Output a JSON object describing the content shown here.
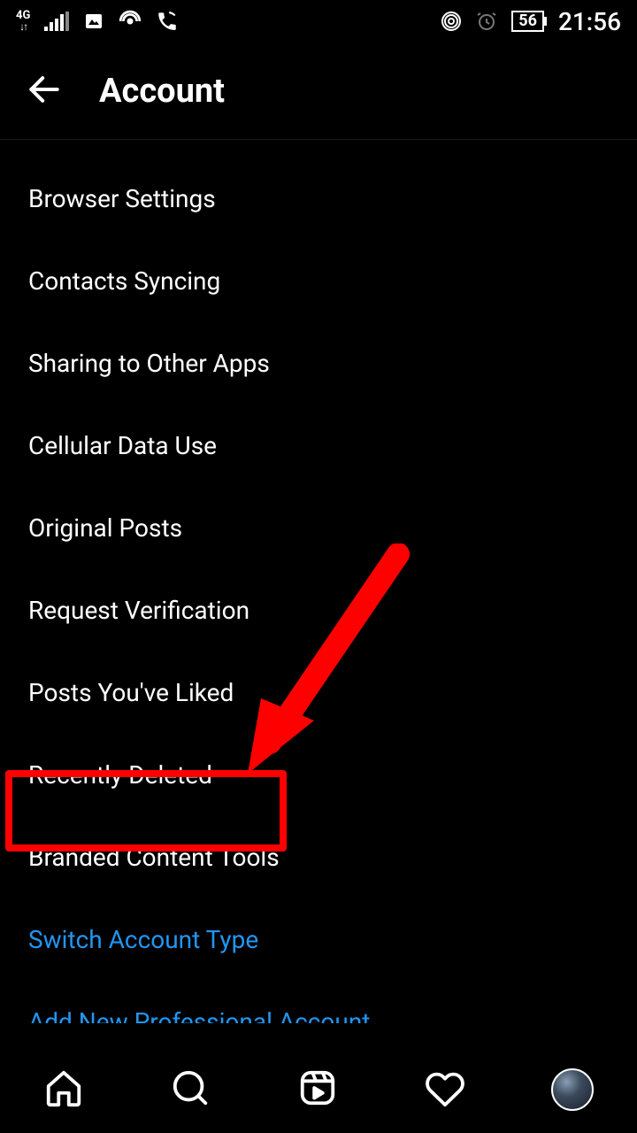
{
  "status": {
    "network_label": "4G",
    "battery": "56",
    "time": "21:56"
  },
  "header": {
    "title": "Account"
  },
  "menu": {
    "items": [
      {
        "label": "Browser Settings",
        "style": "normal"
      },
      {
        "label": "Contacts Syncing",
        "style": "normal"
      },
      {
        "label": "Sharing to Other Apps",
        "style": "normal"
      },
      {
        "label": "Cellular Data Use",
        "style": "normal"
      },
      {
        "label": "Original Posts",
        "style": "normal"
      },
      {
        "label": "Request Verification",
        "style": "normal"
      },
      {
        "label": "Posts You've Liked",
        "style": "normal"
      },
      {
        "label": "Recently Deleted",
        "style": "normal",
        "highlighted": true
      },
      {
        "label": "Branded Content Tools",
        "style": "normal"
      },
      {
        "label": "Switch Account Type",
        "style": "link"
      },
      {
        "label": "Add New Professional Account",
        "style": "link-cutoff"
      }
    ]
  },
  "annotation": {
    "target_label": "Recently Deleted"
  }
}
